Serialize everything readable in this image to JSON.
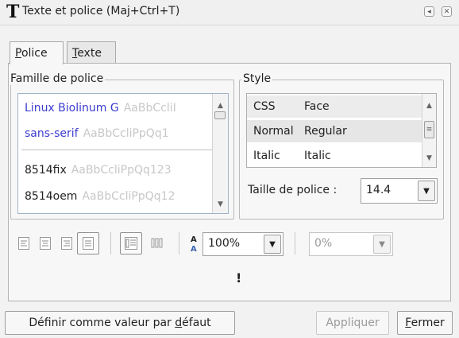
{
  "window": {
    "title": "Texte et police (Maj+Ctrl+T)",
    "title_icon": "T",
    "controls": [
      "restore-icon",
      "close-icon"
    ]
  },
  "tabs": [
    {
      "label": "Police",
      "underline": "P",
      "rest": "olice",
      "active": true
    },
    {
      "label": "Texte",
      "underline": "T",
      "rest": "exte",
      "active": false
    }
  ],
  "font_family": {
    "group_label": "Famille de police",
    "items": [
      {
        "name": "Linux Biolinum G",
        "sample": "AaBbCcliI",
        "color": "#3b3bd1"
      },
      {
        "name": "sans-serif",
        "sample": "AaBbCcliPpQq1",
        "color": "#3b3bd1"
      },
      {
        "name": "8514fix",
        "sample": "AaBbCcliPpQq123",
        "color": "#222222"
      },
      {
        "name": "8514oem",
        "sample": "AaBbCcliPpQq12",
        "color": "#222222"
      }
    ]
  },
  "style": {
    "group_label": "Style",
    "columns": [
      "CSS",
      "Face"
    ],
    "rows": [
      {
        "css": "Normal",
        "face": "Regular",
        "selected": true
      },
      {
        "css": "Italic",
        "face": "Italic",
        "selected": false
      }
    ]
  },
  "font_size": {
    "label": "Taille de police :",
    "value": "14.4"
  },
  "toolbar": {
    "align_icons": [
      "align-left-icon",
      "align-center-icon",
      "align-right-icon",
      "align-justify-icon"
    ],
    "orientation_icons": [
      "horizontal-text-icon",
      "vertical-text-icon"
    ],
    "line_spacing_icon": "line-spacing-icon",
    "line_spacing_value": "100%",
    "letter_spacing_value": "0%"
  },
  "preview": {
    "text": "!"
  },
  "buttons": {
    "default_label": "Définir comme valeur par ",
    "default_underline": "d",
    "default_rest": "éfaut",
    "apply_label": "Appliquer",
    "close_underline": "F",
    "close_rest": "ermer"
  }
}
